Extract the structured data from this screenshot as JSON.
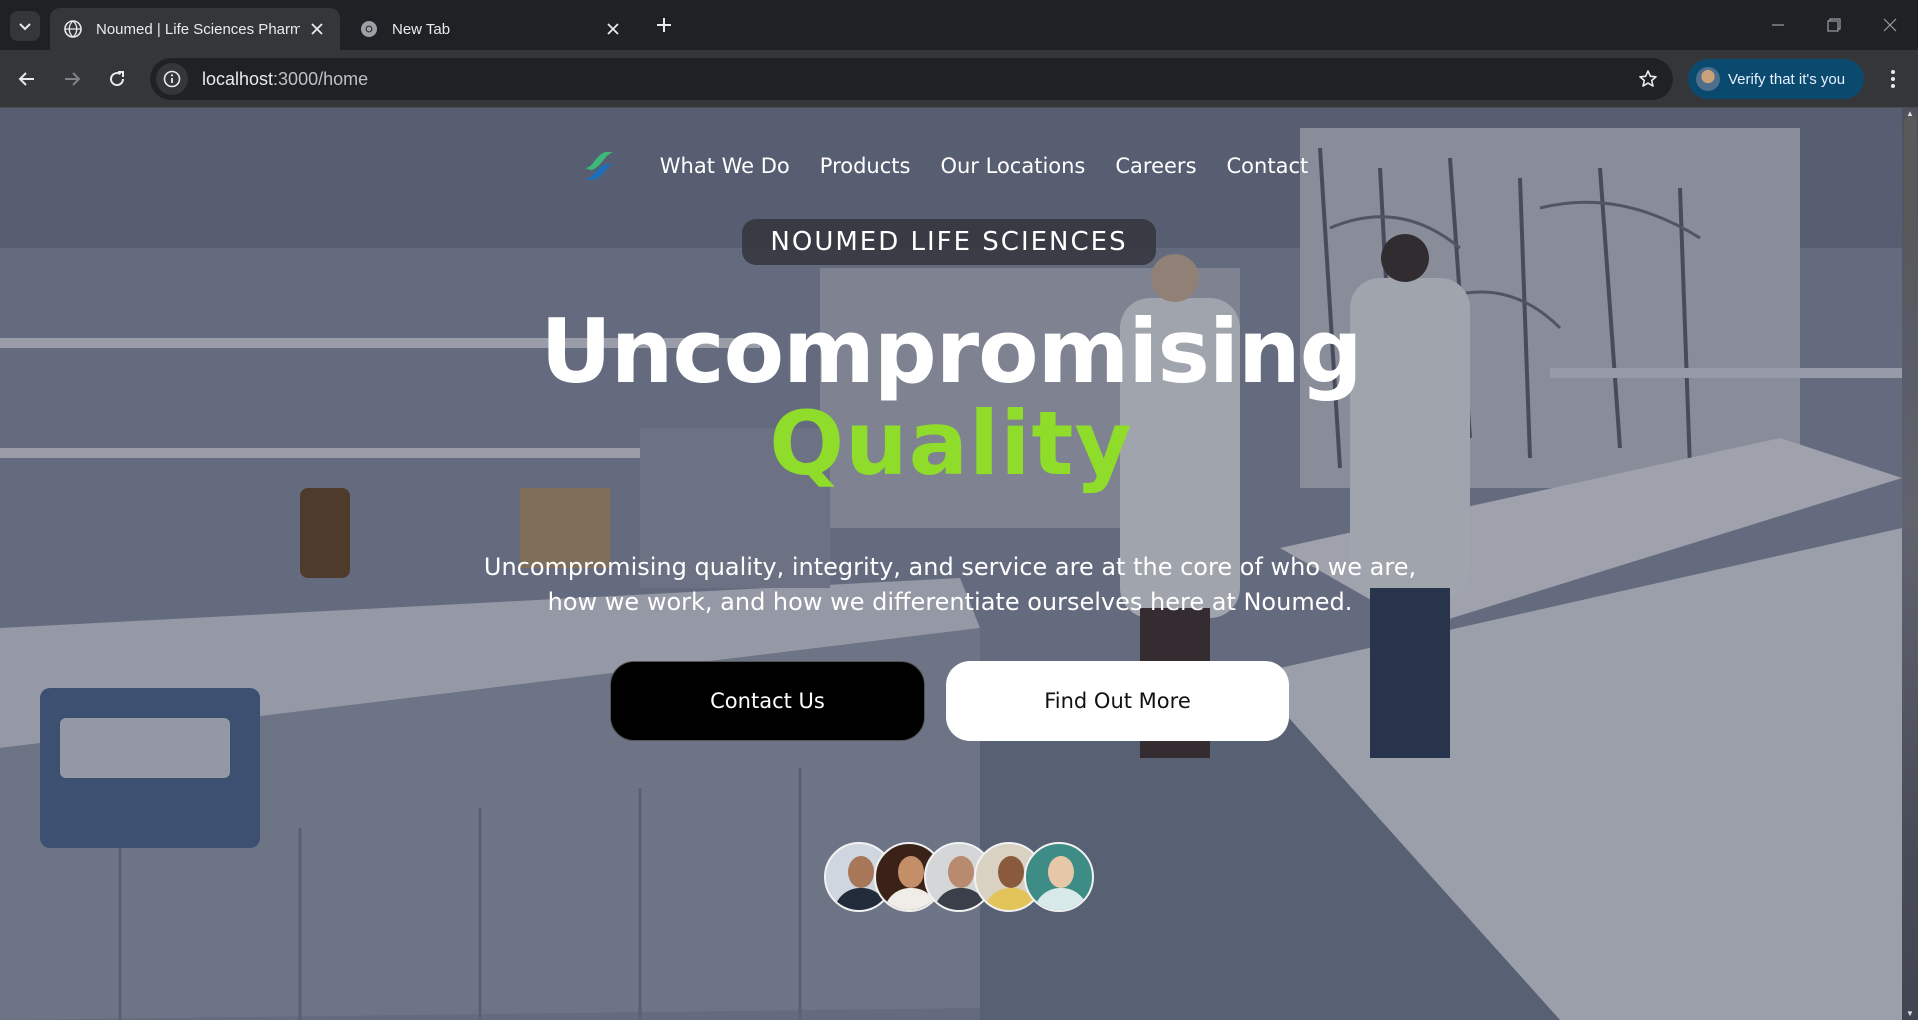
{
  "browser": {
    "tabs": [
      {
        "title": "Noumed | Life Sciences Pharma",
        "active": true
      },
      {
        "title": "New Tab",
        "active": false
      }
    ],
    "url_host": "localhost",
    "url_path": ":3000/home",
    "verify_label": "Verify that it's you"
  },
  "site": {
    "nav": [
      "What We Do",
      "Products",
      "Our Locations",
      "Careers",
      "Contact"
    ],
    "badge": "NOUMED LIFE SCIENCES",
    "headline_line1": "Uncompromising",
    "headline_line2": "Quality",
    "subtext_line1": "Uncompromising quality, integrity, and service are at the core of who we are,",
    "subtext_line2": "how we work, and how we differentiate ourselves here at Noumed.",
    "cta_primary": "Contact Us",
    "cta_secondary": "Find Out More",
    "brand_green": "#8fdc2a",
    "team_avatar_count": 5
  }
}
